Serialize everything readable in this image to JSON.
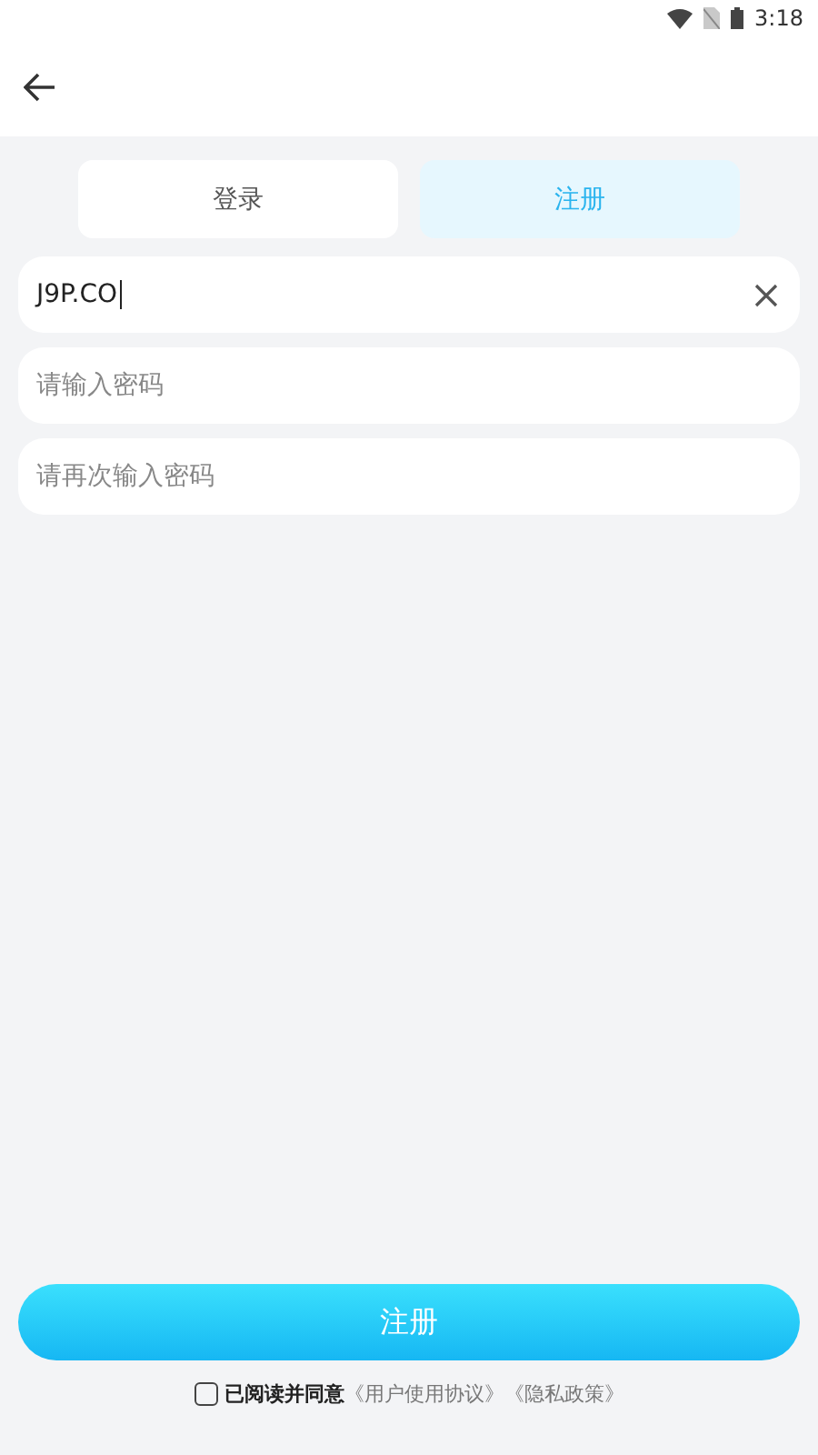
{
  "status_bar": {
    "time": "3:18"
  },
  "tabs": [
    {
      "label": "登录",
      "selected": false
    },
    {
      "label": "注册",
      "selected": true
    }
  ],
  "fields": [
    {
      "kind": "text",
      "value": "J9P.CO",
      "clearable": true
    },
    {
      "kind": "password",
      "placeholder": "请输入密码",
      "clearable": false
    },
    {
      "kind": "password",
      "placeholder": "请再次输入密码",
      "clearable": false
    }
  ],
  "submit_button": {
    "label": "注册"
  },
  "agreement": {
    "checked": false,
    "text": "已阅读并同意",
    "links": [
      "《用户使用协议》",
      "《隐私政策》"
    ]
  }
}
